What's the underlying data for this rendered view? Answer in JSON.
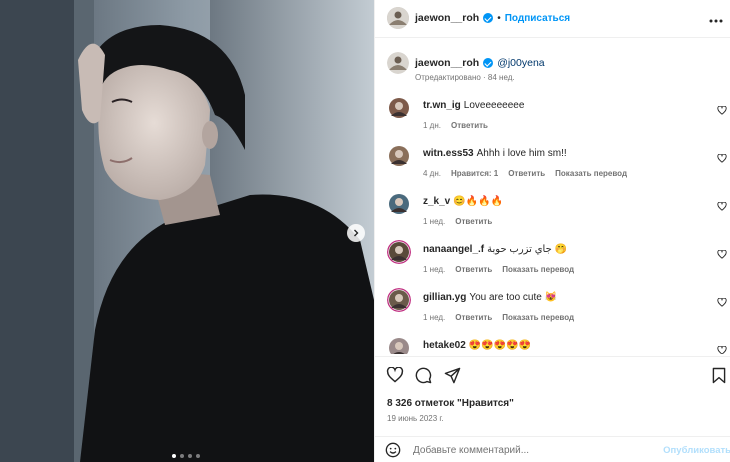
{
  "post": {
    "author": "jaewon__roh",
    "separator": "•",
    "follow_label": "Подписаться",
    "more_icon": "more-horizontal-icon",
    "caption": {
      "author": "jaewon__roh",
      "mention": "@j00yena",
      "meta": "Отредактировано · 84 нед."
    },
    "carousel": {
      "current": 1,
      "total": 4
    }
  },
  "comments": [
    {
      "user": "tr.wn_ig",
      "text": "Loveeeeeeee",
      "meta": [
        {
          "t": "1 дн.",
          "a": false
        },
        {
          "t": "Ответить",
          "a": true
        }
      ]
    },
    {
      "user": "witn.ess53",
      "text": "Ahhh i love him sm!!",
      "meta": [
        {
          "t": "4 дн.",
          "a": false
        },
        {
          "t": "Нравится: 1",
          "a": true
        },
        {
          "t": "Ответить",
          "a": true
        },
        {
          "t": "Показать перевод",
          "a": true
        }
      ]
    },
    {
      "user": "z_k_v",
      "text": "😊🔥🔥🔥",
      "meta": [
        {
          "t": "1 нед.",
          "a": false
        },
        {
          "t": "Ответить",
          "a": true
        }
      ]
    },
    {
      "user": "nanaangel_.f",
      "text": "جاي تزرب حوبة 🤭",
      "meta": [
        {
          "t": "1 нед.",
          "a": false
        },
        {
          "t": "Ответить",
          "a": true
        },
        {
          "t": "Показать перевод",
          "a": true
        }
      ]
    },
    {
      "user": "gillian.yg",
      "text": "You are too cute 😻",
      "meta": [
        {
          "t": "1 нед.",
          "a": false
        },
        {
          "t": "Ответить",
          "a": true
        },
        {
          "t": "Показать перевод",
          "a": true
        }
      ]
    },
    {
      "user": "hetake02",
      "text": "😍😍😍😍😍",
      "meta": []
    }
  ],
  "actions": {
    "likes": "8 326 отметок \"Нравится\"",
    "date": "19 июнь 2023 г."
  },
  "add_comment": {
    "placeholder": "Добавьте комментарий...",
    "publish_label": "Опубликовать"
  },
  "colors": {
    "accent": "#0095f6",
    "text": "#262626",
    "muted": "#737373",
    "publish_disabled": "#b2dffc"
  }
}
